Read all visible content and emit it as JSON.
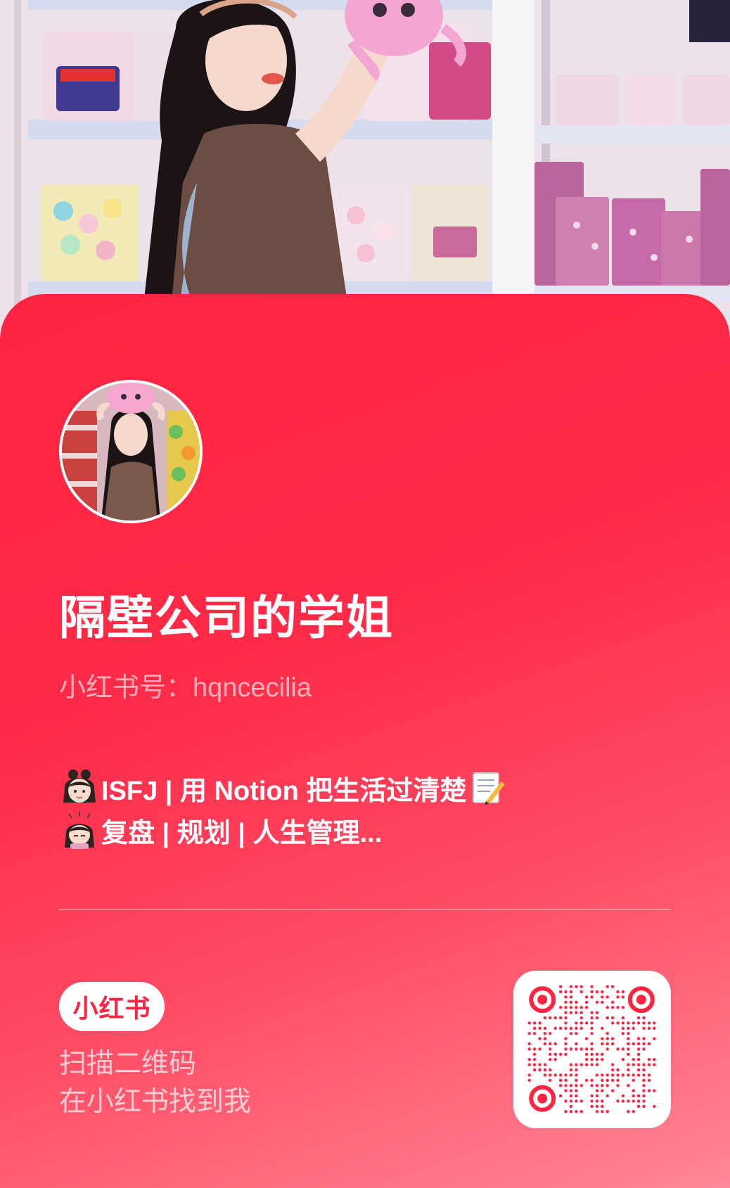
{
  "profile": {
    "display_name": "隔壁公司的学姐",
    "account_label": "小红书号：",
    "account_id": "hqncecilia",
    "bio_lines": [
      {
        "emoji": "girl-face-emoji",
        "text": "ISFJ | 用 Notion 把生活过清楚",
        "trailing_emoji": "memo-emoji"
      },
      {
        "emoji": "girl-bowing-emoji",
        "text": "复盘 | 规划 | 人生管理..."
      }
    ]
  },
  "brand": {
    "logo_text": "小红书",
    "accent_color": "#ff2442"
  },
  "scan": {
    "line1": "扫描二维码",
    "line2": "在小红书找到我"
  },
  "icons": {
    "qr": "qr-code",
    "avatar": "profile-photo",
    "hero": "cover-photo"
  }
}
